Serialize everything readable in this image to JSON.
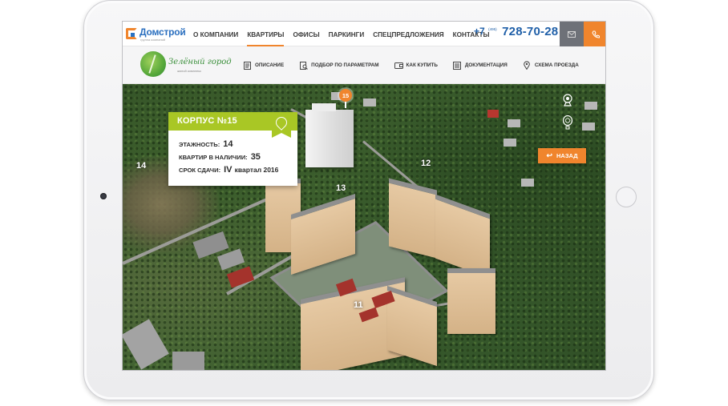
{
  "topbar": {
    "logo": {
      "text": "Домстрой",
      "subtitle": "группа компаний"
    },
    "nav": [
      {
        "label": "О КОМПАНИИ",
        "active": false
      },
      {
        "label": "КВАРТИРЫ",
        "active": true
      },
      {
        "label": "ОФИСЫ",
        "active": false
      },
      {
        "label": "ПАРКИНГИ",
        "active": false
      },
      {
        "label": "СПЕЦПРЕДЛОЖЕНИЯ",
        "active": false
      },
      {
        "label": "КОНТАКТЫ",
        "active": false
      }
    ],
    "phone": {
      "prefix": "+7",
      "code": "(495)",
      "number": "728-70-28"
    },
    "icons": {
      "mail": "mail-icon",
      "call": "phone-icon"
    },
    "colors": {
      "accent": "#f0852d",
      "mail_bg": "#6e7178",
      "phone": "#1f5fa8"
    }
  },
  "subbar": {
    "logo": {
      "title": "Зелёный город",
      "subtitle": "жилой комплекс"
    },
    "nav": [
      {
        "label": "ОПИСАНИЕ",
        "icon": "document-icon"
      },
      {
        "label": "ПОДБОР ПО ПАРАМЕТРАМ",
        "icon": "search-document-icon"
      },
      {
        "label": "КАК КУПИТЬ",
        "icon": "wallet-icon"
      },
      {
        "label": "ДОКУМЕНТАЦИЯ",
        "icon": "list-icon"
      },
      {
        "label": "СХЕМА ПРОЕЗДА",
        "icon": "map-pin-icon"
      }
    ]
  },
  "map": {
    "building_labels": [
      "11",
      "12",
      "13",
      "14"
    ],
    "selected_pin": "15",
    "card": {
      "title": "КОРПУС №15",
      "rows": [
        {
          "label": "ЭТАЖНОСТЬ:",
          "value": "14"
        },
        {
          "label": "КВАРТИР В НАЛИЧИИ:",
          "value": "35"
        },
        {
          "label": "СРОК СДАЧИ:",
          "value_main": "IV",
          "value_rest": "квартал 2016"
        }
      ],
      "color": "#a9c725"
    },
    "controls": {
      "webcam": "webcam-icon",
      "balloon": "balloon-icon"
    },
    "back_button": {
      "label": "НАЗАД",
      "icon": "back-arrow-icon"
    }
  }
}
